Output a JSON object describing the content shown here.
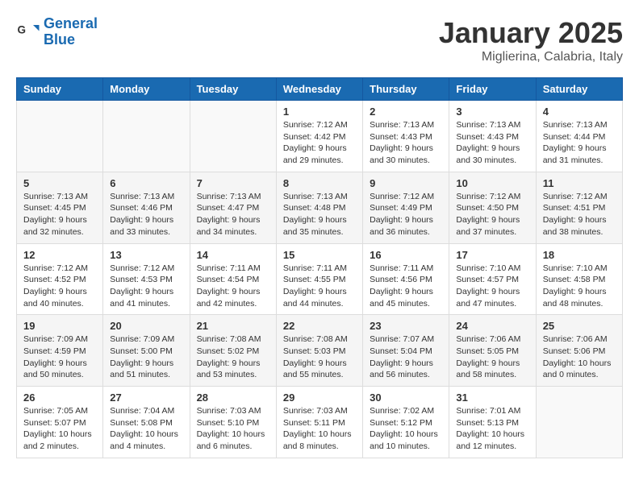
{
  "logo": {
    "line1": "General",
    "line2": "Blue"
  },
  "title": "January 2025",
  "location": "Miglierina, Calabria, Italy",
  "weekdays": [
    "Sunday",
    "Monday",
    "Tuesday",
    "Wednesday",
    "Thursday",
    "Friday",
    "Saturday"
  ],
  "weeks": [
    [
      {
        "day": "",
        "info": ""
      },
      {
        "day": "",
        "info": ""
      },
      {
        "day": "",
        "info": ""
      },
      {
        "day": "1",
        "info": "Sunrise: 7:12 AM\nSunset: 4:42 PM\nDaylight: 9 hours\nand 29 minutes."
      },
      {
        "day": "2",
        "info": "Sunrise: 7:13 AM\nSunset: 4:43 PM\nDaylight: 9 hours\nand 30 minutes."
      },
      {
        "day": "3",
        "info": "Sunrise: 7:13 AM\nSunset: 4:43 PM\nDaylight: 9 hours\nand 30 minutes."
      },
      {
        "day": "4",
        "info": "Sunrise: 7:13 AM\nSunset: 4:44 PM\nDaylight: 9 hours\nand 31 minutes."
      }
    ],
    [
      {
        "day": "5",
        "info": "Sunrise: 7:13 AM\nSunset: 4:45 PM\nDaylight: 9 hours\nand 32 minutes."
      },
      {
        "day": "6",
        "info": "Sunrise: 7:13 AM\nSunset: 4:46 PM\nDaylight: 9 hours\nand 33 minutes."
      },
      {
        "day": "7",
        "info": "Sunrise: 7:13 AM\nSunset: 4:47 PM\nDaylight: 9 hours\nand 34 minutes."
      },
      {
        "day": "8",
        "info": "Sunrise: 7:13 AM\nSunset: 4:48 PM\nDaylight: 9 hours\nand 35 minutes."
      },
      {
        "day": "9",
        "info": "Sunrise: 7:12 AM\nSunset: 4:49 PM\nDaylight: 9 hours\nand 36 minutes."
      },
      {
        "day": "10",
        "info": "Sunrise: 7:12 AM\nSunset: 4:50 PM\nDaylight: 9 hours\nand 37 minutes."
      },
      {
        "day": "11",
        "info": "Sunrise: 7:12 AM\nSunset: 4:51 PM\nDaylight: 9 hours\nand 38 minutes."
      }
    ],
    [
      {
        "day": "12",
        "info": "Sunrise: 7:12 AM\nSunset: 4:52 PM\nDaylight: 9 hours\nand 40 minutes."
      },
      {
        "day": "13",
        "info": "Sunrise: 7:12 AM\nSunset: 4:53 PM\nDaylight: 9 hours\nand 41 minutes."
      },
      {
        "day": "14",
        "info": "Sunrise: 7:11 AM\nSunset: 4:54 PM\nDaylight: 9 hours\nand 42 minutes."
      },
      {
        "day": "15",
        "info": "Sunrise: 7:11 AM\nSunset: 4:55 PM\nDaylight: 9 hours\nand 44 minutes."
      },
      {
        "day": "16",
        "info": "Sunrise: 7:11 AM\nSunset: 4:56 PM\nDaylight: 9 hours\nand 45 minutes."
      },
      {
        "day": "17",
        "info": "Sunrise: 7:10 AM\nSunset: 4:57 PM\nDaylight: 9 hours\nand 47 minutes."
      },
      {
        "day": "18",
        "info": "Sunrise: 7:10 AM\nSunset: 4:58 PM\nDaylight: 9 hours\nand 48 minutes."
      }
    ],
    [
      {
        "day": "19",
        "info": "Sunrise: 7:09 AM\nSunset: 4:59 PM\nDaylight: 9 hours\nand 50 minutes."
      },
      {
        "day": "20",
        "info": "Sunrise: 7:09 AM\nSunset: 5:00 PM\nDaylight: 9 hours\nand 51 minutes."
      },
      {
        "day": "21",
        "info": "Sunrise: 7:08 AM\nSunset: 5:02 PM\nDaylight: 9 hours\nand 53 minutes."
      },
      {
        "day": "22",
        "info": "Sunrise: 7:08 AM\nSunset: 5:03 PM\nDaylight: 9 hours\nand 55 minutes."
      },
      {
        "day": "23",
        "info": "Sunrise: 7:07 AM\nSunset: 5:04 PM\nDaylight: 9 hours\nand 56 minutes."
      },
      {
        "day": "24",
        "info": "Sunrise: 7:06 AM\nSunset: 5:05 PM\nDaylight: 9 hours\nand 58 minutes."
      },
      {
        "day": "25",
        "info": "Sunrise: 7:06 AM\nSunset: 5:06 PM\nDaylight: 10 hours\nand 0 minutes."
      }
    ],
    [
      {
        "day": "26",
        "info": "Sunrise: 7:05 AM\nSunset: 5:07 PM\nDaylight: 10 hours\nand 2 minutes."
      },
      {
        "day": "27",
        "info": "Sunrise: 7:04 AM\nSunset: 5:08 PM\nDaylight: 10 hours\nand 4 minutes."
      },
      {
        "day": "28",
        "info": "Sunrise: 7:03 AM\nSunset: 5:10 PM\nDaylight: 10 hours\nand 6 minutes."
      },
      {
        "day": "29",
        "info": "Sunrise: 7:03 AM\nSunset: 5:11 PM\nDaylight: 10 hours\nand 8 minutes."
      },
      {
        "day": "30",
        "info": "Sunrise: 7:02 AM\nSunset: 5:12 PM\nDaylight: 10 hours\nand 10 minutes."
      },
      {
        "day": "31",
        "info": "Sunrise: 7:01 AM\nSunset: 5:13 PM\nDaylight: 10 hours\nand 12 minutes."
      },
      {
        "day": "",
        "info": ""
      }
    ]
  ]
}
